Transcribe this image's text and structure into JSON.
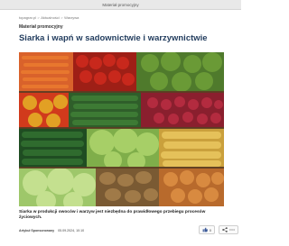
{
  "topbar": {
    "label": "Materiał promocyjny"
  },
  "breadcrumb": [
    "topagrar.pl",
    "Aktualności",
    "Warzywa"
  ],
  "category": "Materiał promocyjny",
  "article": {
    "title": "Siarka i wapń w sadownictwie i warzywnictwie",
    "caption": "Siarka w produkcji owoców i warzyw jest niezbędna do prawidłowego przebiegu procesów życiowych.",
    "author": "Artykuł Sponsorowany",
    "date": "05.09.2024, 10:10",
    "likes": "0"
  },
  "icons": {
    "like": "thumbs-up-icon",
    "share": "share-icon",
    "more": "more-icon"
  }
}
